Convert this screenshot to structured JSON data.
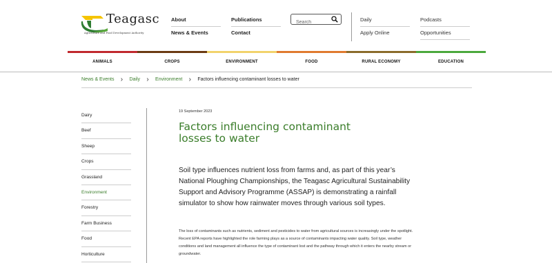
{
  "logo": {
    "name": "Teagasc",
    "subtitle": "Agriculture and Food Development Authority"
  },
  "topnav": {
    "col1": [
      "About",
      "News & Events"
    ],
    "col2": [
      "Publications",
      "Contact"
    ],
    "col3": [
      "Daily",
      "Apply Online"
    ],
    "col4": [
      "Podcasts",
      "Opportunities"
    ]
  },
  "search": {
    "placeholder": "Search",
    "value": ""
  },
  "categories": [
    {
      "label": "ANIMALS",
      "color": "#c0282d"
    },
    {
      "label": "CROPS",
      "color": "#6b3a12"
    },
    {
      "label": "ENVIRONMENT",
      "color": "#f2d36b"
    },
    {
      "label": "FOOD",
      "color": "#e07a2e"
    },
    {
      "label": "RURAL ECONOMY",
      "color": "#8a6b2a"
    },
    {
      "label": "EDUCATION",
      "color": "#4aa83c"
    }
  ],
  "breadcrumb": [
    "News & Events",
    "Daily",
    "Environment",
    "Factors influencing contaminant losses to water"
  ],
  "sidebar": {
    "items": [
      "Dairy",
      "Beef",
      "Sheep",
      "Crops",
      "Grassland",
      "Environment",
      "Forestry",
      "Farm Business",
      "Food",
      "Horticulture"
    ],
    "active": "Environment"
  },
  "article": {
    "date": "19 September 2023",
    "title": "Factors influencing contaminant losses to water",
    "lead": "Soil type influences nutrient loss from farms and, as part of this year’s National Ploughing Championships, the Teagasc Agricultural Sustainability Support and Advisory Programme (ASSAP) is demonstrating a rainfall simulator to show how rainwater moves through various soil types.",
    "body": "The loss of contaminants such as nutrients, sediment and pesticides to water from agricultural sources is increasingly under the spotlight. Recent EPA reports have highlighted the role farming plays as a source of contaminants impacting water quality. Soil type, weather conditions and land management all influence the type of contaminant lost and the pathway through which it enters the nearby stream or groundwater."
  },
  "colors": {
    "accent_green": "#3a7d2a"
  }
}
